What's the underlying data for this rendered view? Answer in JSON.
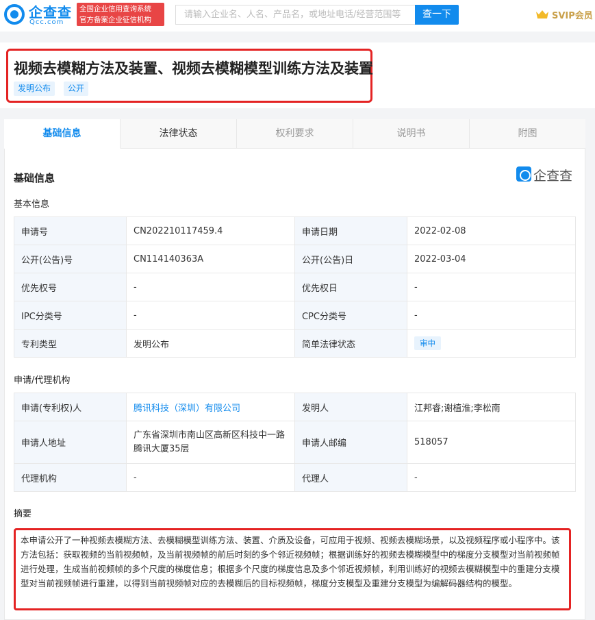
{
  "header": {
    "logo_cn": "企查查",
    "logo_en": "Qcc.com",
    "badge_line1": "全国企业信用查询系统",
    "badge_line2": "官方备案企业征信机构",
    "search_placeholder": "请输入企业名、人名、产品名，或地址电话/经营范围等",
    "search_button": "查一下",
    "vip_label": "SVIP会员"
  },
  "patent": {
    "title": "视频去模糊方法及装置、视频去模糊模型训练方法及装置",
    "tags": [
      "发明公布",
      "公开"
    ]
  },
  "tabs": [
    "基础信息",
    "法律状态",
    "权利要求",
    "说明书",
    "附图"
  ],
  "section_title": "基础信息",
  "watermark": "企查查",
  "basic": {
    "subtitle": "基本信息",
    "rows": [
      {
        "l1": "申请号",
        "v1": "CN202210117459.4",
        "l2": "申请日期",
        "v2": "2022-02-08"
      },
      {
        "l1": "公开(公告)号",
        "v1": "CN114140363A",
        "l2": "公开(公告)日",
        "v2": "2022-03-04"
      },
      {
        "l1": "优先权号",
        "v1": "-",
        "l2": "优先权日",
        "v2": "-"
      },
      {
        "l1": "IPC分类号",
        "v1": "-",
        "l2": "CPC分类号",
        "v2": "-"
      },
      {
        "l1": "专利类型",
        "v1": "发明公布",
        "l2": "简单法律状态",
        "v2": "审中"
      }
    ]
  },
  "agency": {
    "subtitle": "申请/代理机构",
    "applicant_label": "申请(专利权)人",
    "applicant": "腾讯科技（深圳）有限公司",
    "inventor_label": "发明人",
    "inventor": "江邦睿;谢植淮;李松南",
    "address_label": "申请人地址",
    "address_line1": "广东省深圳市南山区高新区科技中一路",
    "address_line2": "腾讯大厦35层",
    "postcode_label": "申请人邮编",
    "postcode": "518057",
    "agency_label": "代理机构",
    "agency": "-",
    "agent_label": "代理人",
    "agent": "-"
  },
  "abstract": {
    "subtitle": "摘要",
    "text": "本申请公开了一种视频去模糊方法、去模糊模型训练方法、装置、介质及设备，可应用于视频、视频去模糊场景，以及视频程序或小程序中。该方法包括：获取视频的当前视频帧，及当前视频帧的前后时刻的多个邻近视频帧；根据训练好的视频去模糊模型中的梯度分支模型对当前视频帧进行处理，生成当前视频帧的多个尺度的梯度信息；根据多个尺度的梯度信息及多个邻近视频帧，利用训练好的视频去模糊模型中的重建分支模型对当前视频帧进行重建，以得到当前视频帧对应的去模糊后的目标视频帧，梯度分支模型及重建分支模型为编解码器结构的模型。"
  }
}
